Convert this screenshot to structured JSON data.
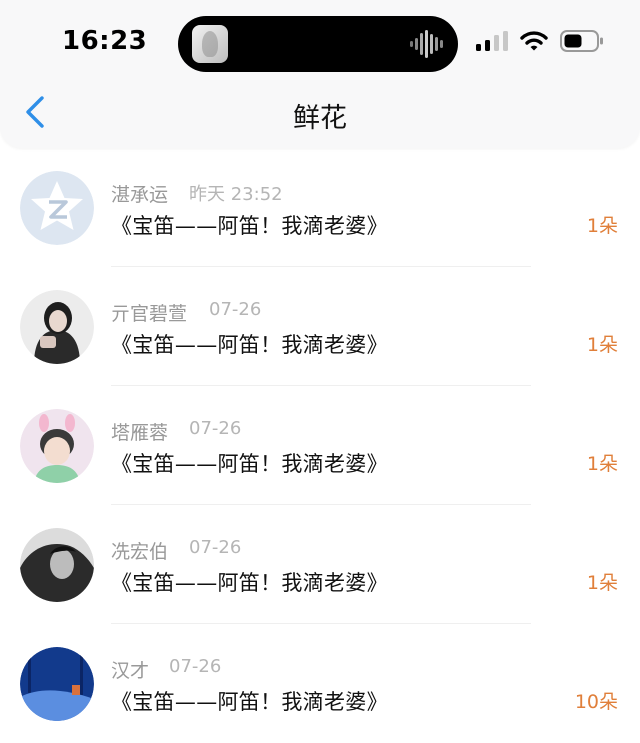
{
  "status_bar": {
    "time": "16:23"
  },
  "nav": {
    "title": "鲜花"
  },
  "colors": {
    "accent_blue": "#2f8fe8",
    "count_orange": "#e07f3a"
  },
  "items": [
    {
      "name": "湛承运",
      "time": "昨天 23:52",
      "content": "《宝笛——阿笛！我滴老婆》",
      "count": "1朵",
      "avatar": "qzone-logo-icon"
    },
    {
      "name": "亓官碧萱",
      "time": "07-26",
      "content": "《宝笛——阿笛！我滴老婆》",
      "count": "1朵",
      "avatar": "avatar-photo"
    },
    {
      "name": "塔雁蓉",
      "time": "07-26",
      "content": "《宝笛——阿笛！我滴老婆》",
      "count": "1朵",
      "avatar": "avatar-photo"
    },
    {
      "name": "冼宏伯",
      "time": "07-26",
      "content": "《宝笛——阿笛！我滴老婆》",
      "count": "1朵",
      "avatar": "avatar-photo"
    },
    {
      "name": "汉才",
      "time": "07-26",
      "content": "《宝笛——阿笛！我滴老婆》",
      "count": "10朵",
      "avatar": "avatar-photo"
    }
  ]
}
